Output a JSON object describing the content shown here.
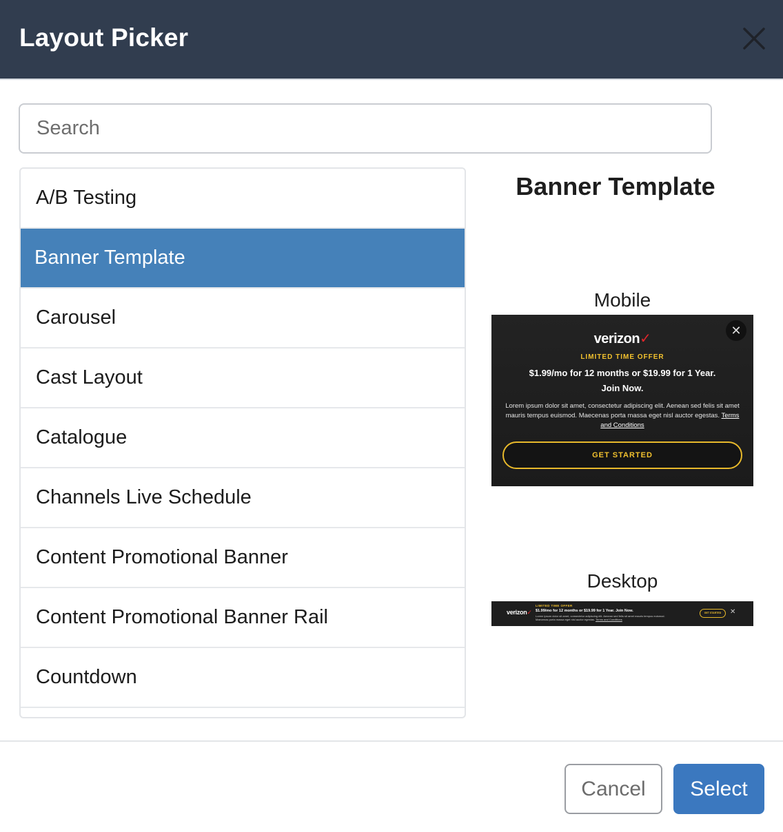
{
  "header": {
    "title": "Layout Picker"
  },
  "search": {
    "placeholder": "Search",
    "value": ""
  },
  "layouts": {
    "items": [
      {
        "label": "A/B Testing"
      },
      {
        "label": "Banner Template"
      },
      {
        "label": "Carousel"
      },
      {
        "label": "Cast Layout"
      },
      {
        "label": "Catalogue"
      },
      {
        "label": "Channels Live Schedule"
      },
      {
        "label": "Content Promotional Banner"
      },
      {
        "label": "Content Promotional Banner Rail"
      },
      {
        "label": "Countdown"
      }
    ],
    "selected": "Banner Template"
  },
  "preview": {
    "title": "Banner Template",
    "mobile_label": "Mobile",
    "desktop_label": "Desktop",
    "banner": {
      "brand": "verizon",
      "brand_mark": "✓",
      "offer_label": "LIMITED TIME OFFER",
      "headline": "$1.99/mo for 12 months or $19.99 for 1 Year. Join Now.",
      "body": "Lorem ipsum dolor sit amet, consectetur adipiscing elit. Aenean sed felis sit amet mauris tempus euismod. Maecenas porta massa eget nisl auctor egestas.",
      "terms_link": "Terms and Conditions",
      "cta": "GET STARTED",
      "close_glyph": "✕"
    }
  },
  "footer": {
    "cancel_label": "Cancel",
    "select_label": "Select"
  },
  "colors": {
    "header_bg": "#313d4f",
    "selected_bg": "#4581b9",
    "primary_button": "#3b78bf",
    "accent_gold": "#f2c12e"
  }
}
